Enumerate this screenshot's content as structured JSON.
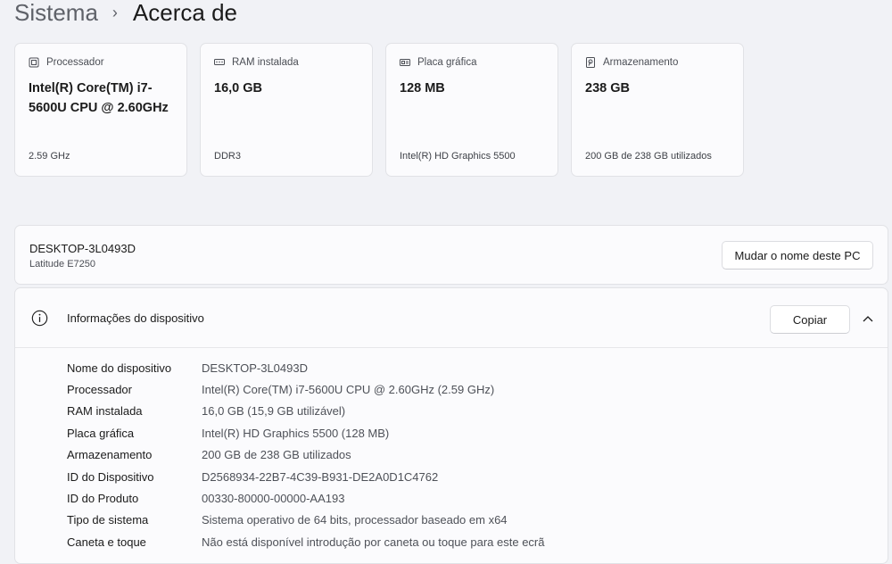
{
  "breadcrumb": {
    "parent": "Sistema",
    "separator": "›",
    "current": "Acerca de"
  },
  "cards": [
    {
      "icon": "processor-icon",
      "label": "Processador",
      "value": "Intel(R) Core(TM) i7-5600U CPU @ 2.60GHz",
      "sub": "2.59 GHz"
    },
    {
      "icon": "ram-icon",
      "label": "RAM instalada",
      "value": "16,0 GB",
      "sub": "DDR3"
    },
    {
      "icon": "graphics-card-icon",
      "label": "Placa gráfica",
      "value": "128 MB",
      "sub": "Intel(R) HD Graphics 5500"
    },
    {
      "icon": "storage-icon",
      "label": "Armazenamento",
      "value": "238 GB",
      "sub": "200 GB de 238 GB utilizados"
    }
  ],
  "pc": {
    "name": "DESKTOP-3L0493D",
    "model": "Latitude E7250",
    "rename_label": "Mudar o nome deste PC"
  },
  "device_info": {
    "title": "Informações do dispositivo",
    "copy_label": "Copiar",
    "rows": [
      {
        "label": "Nome do dispositivo",
        "value": "DESKTOP-3L0493D"
      },
      {
        "label": "Processador",
        "value": "Intel(R) Core(TM) i7-5600U CPU @ 2.60GHz (2.59 GHz)"
      },
      {
        "label": "RAM instalada",
        "value": "16,0 GB (15,9 GB utilizável)"
      },
      {
        "label": "Placa gráfica",
        "value": "Intel(R) HD Graphics 5500 (128 MB)"
      },
      {
        "label": "Armazenamento",
        "value": "200 GB de 238 GB utilizados"
      },
      {
        "label": "ID do Dispositivo",
        "value": "D2568934-22B7-4C39-B931-DE2A0D1C4762"
      },
      {
        "label": "ID do Produto",
        "value": "00330-80000-00000-AA193"
      },
      {
        "label": "Tipo de sistema",
        "value": "Sistema operativo de 64 bits, processador baseado em x64"
      },
      {
        "label": "Caneta e toque",
        "value": "Não está disponível introdução por caneta ou toque para este ecrã"
      }
    ]
  }
}
